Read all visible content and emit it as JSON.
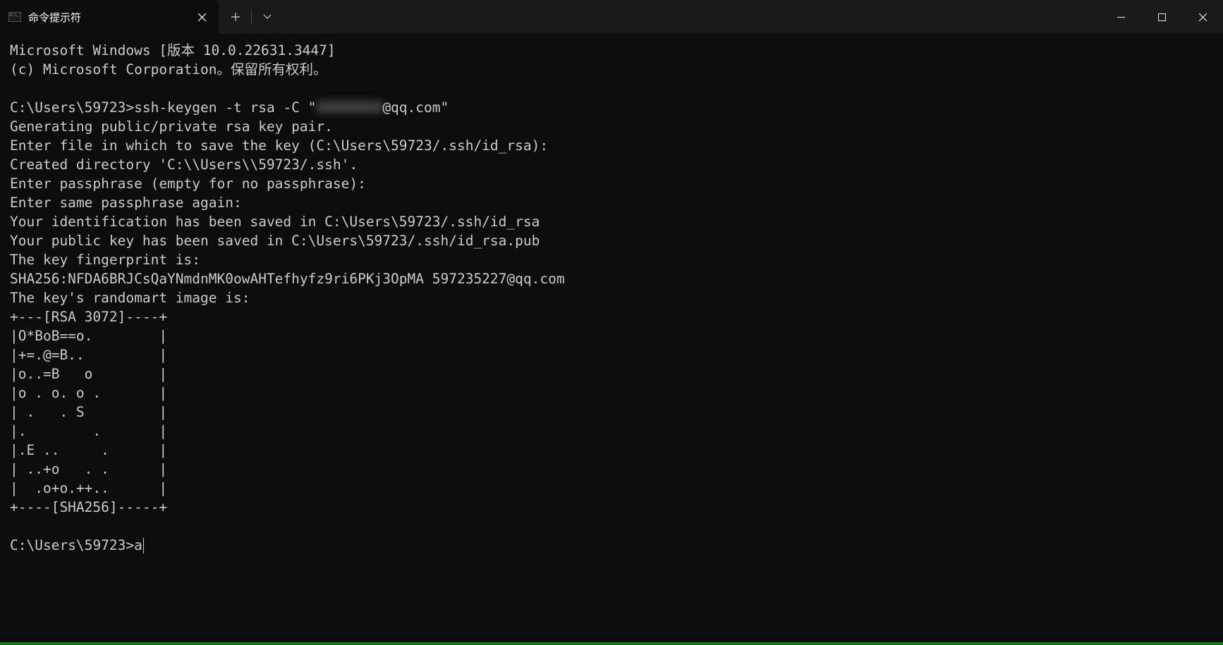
{
  "tab": {
    "title": "命令提示符"
  },
  "terminal": {
    "lines": [
      "Microsoft Windows [版本 10.0.22631.3447]",
      "(c) Microsoft Corporation。保留所有权利。",
      "",
      {
        "prompt": "C:\\Users\\59723>",
        "cmd_pre": "ssh-keygen -t rsa -C \"",
        "redacted": "XXXXXXXX",
        "cmd_post": "@qq.com\""
      },
      "Generating public/private rsa key pair.",
      "Enter file in which to save the key (C:\\Users\\59723/.ssh/id_rsa):",
      "Created directory 'C:\\\\Users\\\\59723/.ssh'.",
      "Enter passphrase (empty for no passphrase):",
      "Enter same passphrase again:",
      "Your identification has been saved in C:\\Users\\59723/.ssh/id_rsa",
      "Your public key has been saved in C:\\Users\\59723/.ssh/id_rsa.pub",
      "The key fingerprint is:",
      "SHA256:NFDA6BRJCsQaYNmdnMK0owAHTefhyfz9ri6PKj3OpMA 597235227@qq.com",
      "The key's randomart image is:",
      "+---[RSA 3072]----+",
      "|O*BoB==o.        |",
      "|+=.@=B..         |",
      "|o..=B   o        |",
      "|o . o. o .       |",
      "| .   . S         |",
      "|.        .       |",
      "|.E ..     .      |",
      "| ..+o   . .      |",
      "|  .o+o.++..      |",
      "+----[SHA256]-----+",
      "",
      {
        "prompt": "C:\\Users\\59723>",
        "input": "a",
        "cursor": true
      }
    ]
  }
}
